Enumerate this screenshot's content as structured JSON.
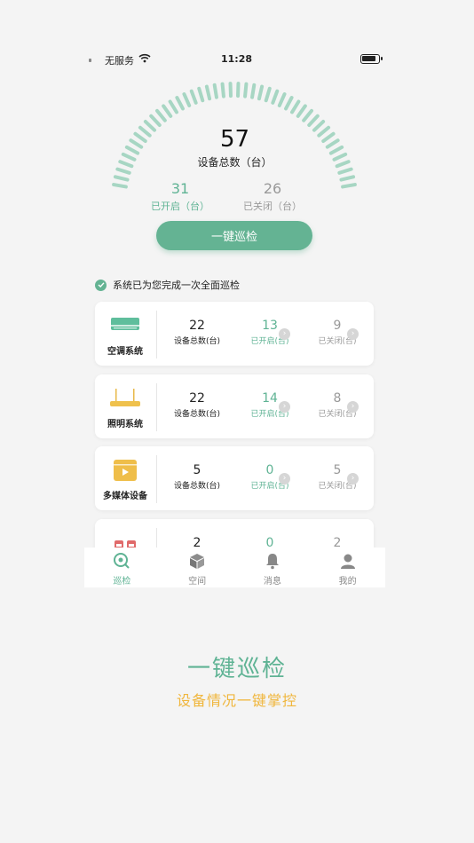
{
  "status_bar": {
    "carrier": "无服务",
    "time": "11:28"
  },
  "gauge": {
    "total": "57",
    "total_label": "设备总数（台）",
    "on_value": "31",
    "on_label": "已开启（台）",
    "off_value": "26",
    "off_label": "已关闭（台）",
    "colors": {
      "tick": "#a7d6c3",
      "accent": "#64b393"
    }
  },
  "inspect_button": "一键巡检",
  "notice": "系统已为您完成一次全面巡检",
  "systems": [
    {
      "name": "空调系统",
      "icon": "air-conditioner-icon",
      "total": "22",
      "total_label": "设备总数(台)",
      "on": "13",
      "on_label": "已开启(台)",
      "off": "9",
      "off_label": "已关闭(台)"
    },
    {
      "name": "照明系统",
      "icon": "lighting-icon",
      "total": "22",
      "total_label": "设备总数(台)",
      "on": "14",
      "on_label": "已开启(台)",
      "off": "8",
      "off_label": "已关闭(台)"
    },
    {
      "name": "多媒体设备",
      "icon": "multimedia-icon",
      "total": "5",
      "total_label": "设备总数(台)",
      "on": "0",
      "on_label": "已开启(台)",
      "off": "5",
      "off_label": "已关闭(台)"
    },
    {
      "name": "",
      "icon": "security-icon",
      "total": "2",
      "total_label": "",
      "on": "0",
      "on_label": "",
      "off": "2",
      "off_label": ""
    }
  ],
  "tabs": [
    {
      "label": "巡检",
      "icon": "inspect-icon",
      "active": true
    },
    {
      "label": "空间",
      "icon": "cube-icon",
      "active": false
    },
    {
      "label": "消息",
      "icon": "bell-icon",
      "active": false
    },
    {
      "label": "我的",
      "icon": "user-icon",
      "active": false
    }
  ],
  "promo": {
    "title": "一键巡检",
    "subtitle": "设备情况一键掌控"
  }
}
